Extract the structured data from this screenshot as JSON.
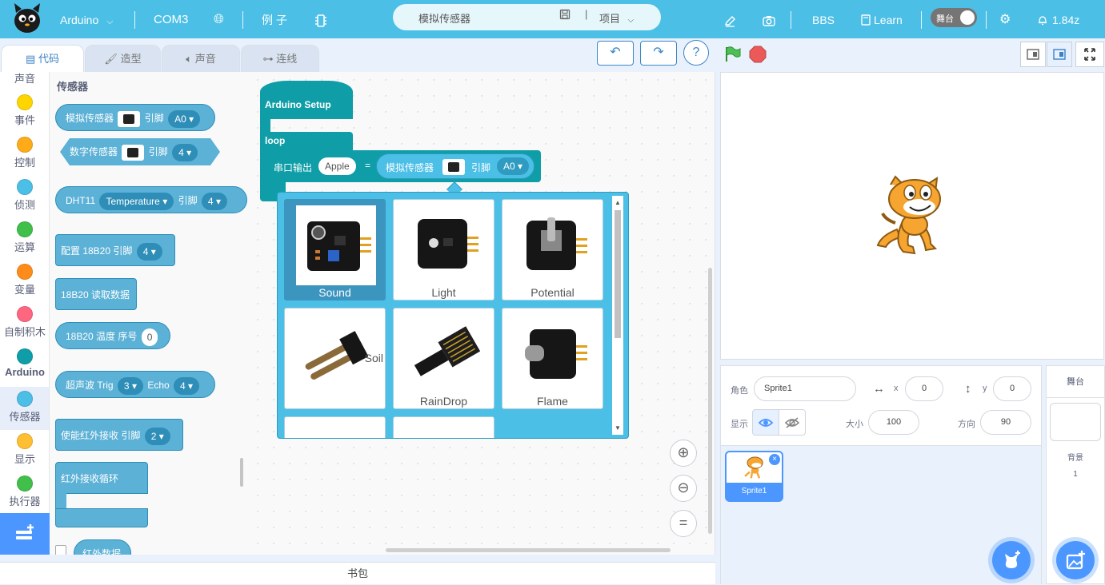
{
  "topbar": {
    "board": "Arduino",
    "port": "COM3",
    "examples": "例 子",
    "project_name": "模拟传感器",
    "project_menu": "项目",
    "bbs": "BBS",
    "learn": "Learn",
    "stage_toggle": "舞台",
    "version": "1.84z"
  },
  "tabs": [
    {
      "label": "代码"
    },
    {
      "label": "造型"
    },
    {
      "label": "声音"
    },
    {
      "label": "连线"
    }
  ],
  "categories": [
    {
      "label": "声音",
      "color": "#cf63cf"
    },
    {
      "label": "事件",
      "color": "#ffd500"
    },
    {
      "label": "控制",
      "color": "#ffab19"
    },
    {
      "label": "侦测",
      "color": "#4cbfe6"
    },
    {
      "label": "运算",
      "color": "#40bf4a"
    },
    {
      "label": "变量",
      "color": "#ff8c1a"
    },
    {
      "label": "自制积木",
      "color": "#ff6680"
    },
    {
      "label": "Arduino",
      "color": "#0f9ea8"
    },
    {
      "label": "传感器",
      "color": "#4cbfe6"
    },
    {
      "label": "显示",
      "color": "#ffbf33"
    },
    {
      "label": "执行器",
      "color": "#40bf4a"
    }
  ],
  "palette": {
    "heading": "传感器",
    "analog_sensor": "模拟传感器",
    "pin": "引脚",
    "pin_a0": "A0",
    "digital_sensor": "数字传感器",
    "pin_4": "4",
    "dht11": "DHT11",
    "temperature": "Temperature",
    "cfg_18b20": "配置 18B20 引脚",
    "read_18b20": "18B20 读取数据",
    "temp_18b20": "18B20 温度 序号",
    "idx_0": "0",
    "ultrasonic": "超声波 Trig",
    "trig_val": "3",
    "echo": "Echo",
    "echo_val": "4",
    "ir_enable": "使能红外接收 引脚",
    "ir_pin": "2",
    "ir_loop": "红外接收循环",
    "ir_data": "红外数据"
  },
  "code": {
    "setup": "Arduino Setup",
    "loop": "loop",
    "serial_print": "串口输出",
    "serial_value": "Apple",
    "equals": "=",
    "analog_sensor": "模拟传感器",
    "pin": "引脚",
    "pin_value": "A0"
  },
  "popup": {
    "sensors": [
      {
        "label": "Sound"
      },
      {
        "label": "Light"
      },
      {
        "label": "Potential"
      },
      {
        "label": "Soil"
      },
      {
        "label": "RainDrop"
      },
      {
        "label": "Flame"
      }
    ],
    "scrollbar_fraction": 0.8
  },
  "sprite_info": {
    "role_label": "角色",
    "sprite_name": "Sprite1",
    "x_label": "x",
    "x_value": "0",
    "y_label": "y",
    "y_value": "0",
    "show_label": "显示",
    "size_label": "大小",
    "size_value": "100",
    "direction_label": "方向",
    "direction_value": "90",
    "thumb_label": "Sprite1"
  },
  "stage_panel": {
    "title": "舞台",
    "backdrop_label": "背景",
    "backdrop_count": "1"
  },
  "backpack": "书包"
}
